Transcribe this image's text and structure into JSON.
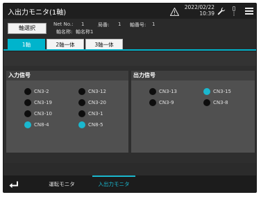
{
  "header": {
    "title": "入出力モニタ(1軸)",
    "date": "2022/02/22",
    "time": "10:39",
    "icons": [
      "warning-icon",
      "wrench-icon",
      "status-indicator-icon",
      "menu-icon"
    ]
  },
  "info": {
    "axis_select_label": "軸選択",
    "net_no_label": "Net No.:",
    "net_no_value": "1",
    "station_label": "局番:",
    "station_value": "1",
    "axis_no_label": "軸番号:",
    "axis_no_value": "1",
    "axis_name_label": "軸名称:",
    "axis_name_value": "軸名称1"
  },
  "tabs": [
    {
      "label": "1軸",
      "active": true
    },
    {
      "label": "2軸一体",
      "active": false
    },
    {
      "label": "3軸一体",
      "active": false
    }
  ],
  "input_panel": {
    "title": "入力信号",
    "signals": [
      {
        "label": "CN3-2",
        "on": false
      },
      {
        "label": "CN3-12",
        "on": false
      },
      {
        "label": "CN3-19",
        "on": false
      },
      {
        "label": "CN3-20",
        "on": false
      },
      {
        "label": "CN3-10",
        "on": false
      },
      {
        "label": "CN3-1",
        "on": false
      },
      {
        "label": "CN8-4",
        "on": true
      },
      {
        "label": "CN8-5",
        "on": true
      }
    ]
  },
  "output_panel": {
    "title": "出力信号",
    "signals": [
      {
        "label": "CN3-13",
        "on": false
      },
      {
        "label": "CN3-15",
        "on": true
      },
      {
        "label": "CN3-9",
        "on": false
      },
      {
        "label": "CN3-8",
        "on": false
      }
    ]
  },
  "bottom_nav": {
    "back_icon": "return-icon",
    "tabs": [
      {
        "label": "運転モニタ",
        "active": false
      },
      {
        "label": "入出力モニタ",
        "active": true
      }
    ]
  },
  "colors": {
    "accent": "#1ab8cf",
    "led_off": "#0d0d0d",
    "panel_bg": "#505050"
  }
}
